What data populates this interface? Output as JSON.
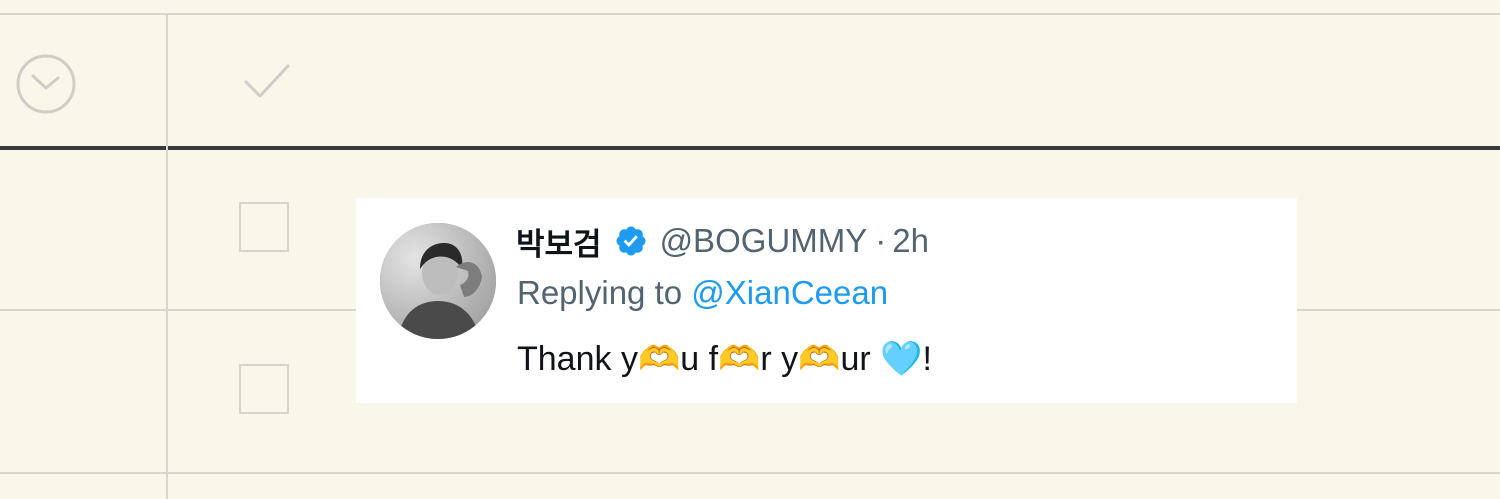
{
  "table": {
    "header_icons": [
      "clock-icon",
      "checkmark-icon"
    ],
    "row_checkboxes": [
      false,
      false
    ]
  },
  "tweet": {
    "display_name": "박보검",
    "verified": true,
    "handle": "@BOGUMMY",
    "separator": "·",
    "time": "2h",
    "replying_prefix": "Replying to ",
    "replying_to": "@XianCeean",
    "text": "Thank y🫶u f🫶r y🫶ur 🩵!",
    "colors": {
      "verified_badge": "#1d9bf0",
      "link": "#1d9bf0",
      "secondary_text": "#536471",
      "primary_text": "#0f1419"
    }
  }
}
